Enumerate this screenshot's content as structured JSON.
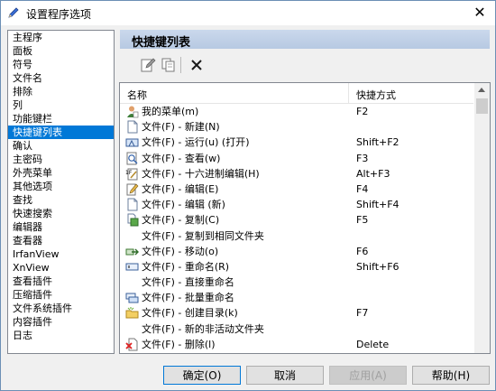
{
  "window": {
    "title": "设置程序选项",
    "close_label": "✕"
  },
  "sidebar": {
    "items": [
      {
        "label": "主程序"
      },
      {
        "label": "面板"
      },
      {
        "label": "符号"
      },
      {
        "label": "文件名"
      },
      {
        "label": "排除"
      },
      {
        "label": "列"
      },
      {
        "label": "功能键栏"
      },
      {
        "label": "快捷键列表"
      },
      {
        "label": "确认"
      },
      {
        "label": "主密码"
      },
      {
        "label": "外壳菜单"
      },
      {
        "label": "其他选项"
      },
      {
        "label": "查找"
      },
      {
        "label": "快速搜索"
      },
      {
        "label": "编辑器"
      },
      {
        "label": "查看器"
      },
      {
        "label": "IrfanView"
      },
      {
        "label": "XnView"
      },
      {
        "label": "查看插件"
      },
      {
        "label": "压缩插件"
      },
      {
        "label": "文件系统插件"
      },
      {
        "label": "内容插件"
      },
      {
        "label": "日志"
      }
    ],
    "selected_index": 7
  },
  "panel": {
    "title": "快捷键列表"
  },
  "toolbar": {
    "icons": [
      "edit-icon",
      "copy-icon",
      "delete-icon"
    ]
  },
  "table": {
    "headers": {
      "name": "名称",
      "shortcut": "快捷方式"
    },
    "rows": [
      {
        "name": "我的菜单(m)",
        "shortcut": "F2",
        "icon": "user-menu-icon"
      },
      {
        "name": "文件(F) - 新建(N)",
        "shortcut": "",
        "icon": "new-file-icon"
      },
      {
        "name": "文件(F) - 运行(u) (打开)",
        "shortcut": "Shift+F2",
        "icon": "run-icon"
      },
      {
        "name": "文件(F) - 查看(w)",
        "shortcut": "F3",
        "icon": "view-icon"
      },
      {
        "name": "文件(F) - 十六进制编辑(H)",
        "shortcut": "Alt+F3",
        "icon": "hex-edit-icon"
      },
      {
        "name": "文件(F) - 编辑(E)",
        "shortcut": "F4",
        "icon": "edit-file-icon"
      },
      {
        "name": "文件(F) - 编辑 (新)",
        "shortcut": "Shift+F4",
        "icon": "new-file-icon"
      },
      {
        "name": "文件(F) - 复制(C)",
        "shortcut": "F5",
        "icon": "copy-file-icon"
      },
      {
        "name": "文件(F) - 复制到相同文件夹",
        "shortcut": "",
        "icon": ""
      },
      {
        "name": "文件(F) - 移动(o)",
        "shortcut": "F6",
        "icon": "move-icon"
      },
      {
        "name": "文件(F) - 重命名(R)",
        "shortcut": "Shift+F6",
        "icon": "rename-icon"
      },
      {
        "name": "文件(F) - 直接重命名",
        "shortcut": "",
        "icon": ""
      },
      {
        "name": "文件(F) - 批量重命名",
        "shortcut": "",
        "icon": "batch-rename-icon"
      },
      {
        "name": "文件(F) - 创建目录(k)",
        "shortcut": "F7",
        "icon": "create-folder-icon"
      },
      {
        "name": "文件(F) - 新的非活动文件夹",
        "shortcut": "",
        "icon": ""
      },
      {
        "name": "文件(F) - 删除(l)",
        "shortcut": "Delete",
        "icon": "delete-file-icon"
      }
    ]
  },
  "buttons": {
    "ok": "确定(O)",
    "cancel": "取消",
    "apply": "应用(A)",
    "help": "帮助(H)"
  },
  "colors": {
    "selection": "#0078d7",
    "header_bg": "#c3d3ea"
  }
}
